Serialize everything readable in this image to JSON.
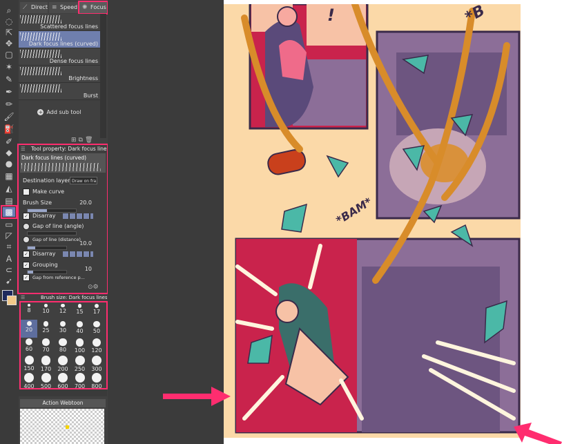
{
  "colors": {
    "accent_highlight": "#ff2d6f",
    "selected_row": "#6f7fae",
    "panel_bg": "#404040",
    "workspace_bg": "#3b3b3b",
    "canvas_bg": "#fbd9a8",
    "main_color": "#1f2a5c",
    "sub_color": "#f2c98a"
  },
  "tabs": [
    {
      "label": "Direct",
      "icon": "direct-icon"
    },
    {
      "label": "Speed",
      "icon": "speed-icon"
    },
    {
      "label": "Focus",
      "icon": "focus-icon",
      "active": true
    }
  ],
  "subtools": [
    {
      "label": "Scattered focus lines"
    },
    {
      "label": "Dark focus lines (curved)",
      "active": true
    },
    {
      "label": "Dense focus lines"
    },
    {
      "label": "Brightness"
    },
    {
      "label": "Burst"
    }
  ],
  "add_sub_tool": "Add sub tool",
  "tool_property": {
    "header": "Tool property: Dark focus lines (curved)",
    "name": "Dark focus lines (curved)",
    "destination_layer": {
      "label": "Destination layer",
      "value": "Draw on fra..."
    },
    "make_curve": "Make curve",
    "brush_size": {
      "label": "Brush Size",
      "value": "20.0"
    },
    "disarray_1": "Disarray",
    "gap_angle": "Gap of line (angle)",
    "gap_distance": {
      "label": "Gap of line (distance)",
      "value": "10.0"
    },
    "disarray_2": "Disarray",
    "grouping": {
      "label": "Grouping",
      "value": "10"
    },
    "gap_reference": "Gap from reference p..."
  },
  "brush_size_panel": {
    "header": "Brush size: Dark focus lines",
    "sizes": [
      "8",
      "10",
      "12",
      "15",
      "17",
      "20",
      "25",
      "30",
      "40",
      "50",
      "60",
      "70",
      "80",
      "100",
      "120",
      "150",
      "170",
      "200",
      "250",
      "300",
      "400",
      "500",
      "600",
      "700",
      "800"
    ],
    "selected": "20"
  },
  "layer_panel": {
    "title": "Action Webtoon"
  },
  "comic": {
    "sfx_top": "!",
    "sfx_bam": "*BAM*",
    "sfx_corner": "*B"
  }
}
